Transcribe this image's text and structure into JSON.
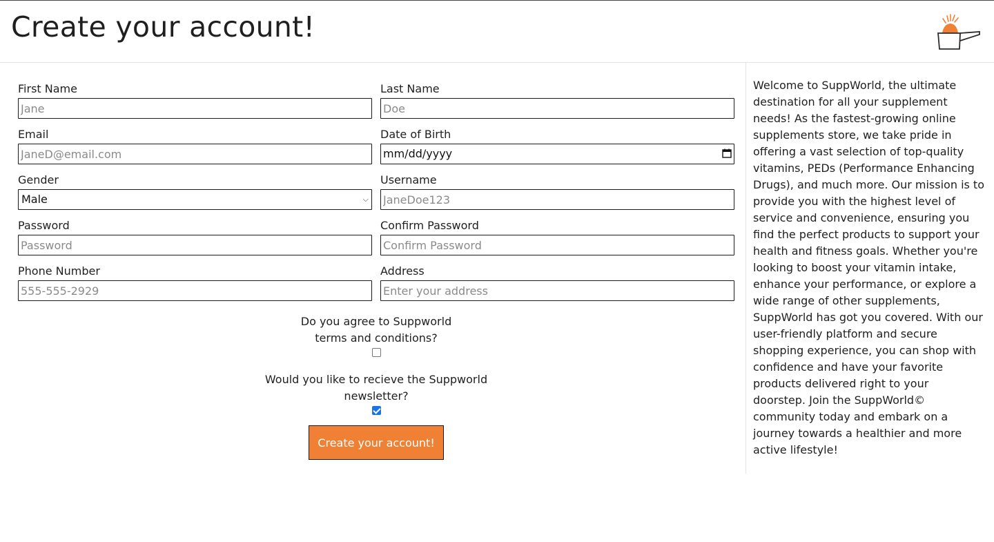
{
  "header": {
    "title": "Create your account!"
  },
  "form": {
    "first_name": {
      "label": "First Name",
      "placeholder": "Jane"
    },
    "last_name": {
      "label": "Last Name",
      "placeholder": "Doe"
    },
    "email": {
      "label": "Email",
      "placeholder": "JaneD@email.com"
    },
    "dob": {
      "label": "Date of Birth",
      "value": "mm/dd/yyyy"
    },
    "gender": {
      "label": "Gender",
      "value": "Male"
    },
    "username": {
      "label": "Username",
      "placeholder": "JaneDoe123"
    },
    "password": {
      "label": "Password",
      "placeholder": "Password"
    },
    "confirm_password": {
      "label": "Confirm Password",
      "placeholder": "Confirm Password"
    },
    "phone": {
      "label": "Phone Number",
      "placeholder": "555-555-2929"
    },
    "address": {
      "label": "Address",
      "placeholder": "Enter your address"
    },
    "terms": {
      "line1": "Do you agree to Suppworld",
      "line2": "terms and conditions?",
      "checked": false
    },
    "newsletter": {
      "line1": "Would you like to recieve the Suppworld",
      "line2": "newsletter?",
      "checked": true
    },
    "submit_label": "Create your account!"
  },
  "sidebar": {
    "welcome_text": "Welcome to SuppWorld, the ultimate destination for all your supplement needs! As the fastest-growing online supplements store, we take pride in offering a vast selection of top-quality vitamins, PEDs (Performance Enhancing Drugs), and much more. Our mission is to provide you with the highest level of service and convenience, ensuring you find the perfect products to support your health and fitness goals. Whether you're looking to boost your vitamin intake, enhance your performance, or explore a wide range of other supplements, SuppWorld has got you covered. With our user-friendly platform and secure shopping experience, you can shop with confidence and have your favorite products delivered right to your doorstep. Join the SuppWorld© community today and embark on a journey towards a healthier and more active lifestyle!"
  },
  "colors": {
    "accent": "#f08033",
    "checkbox": "#1a73e8"
  },
  "icons": {
    "logo": "supplement-scoop-icon",
    "calendar": "calendar-icon",
    "dropdown": "chevron-down-icon"
  }
}
